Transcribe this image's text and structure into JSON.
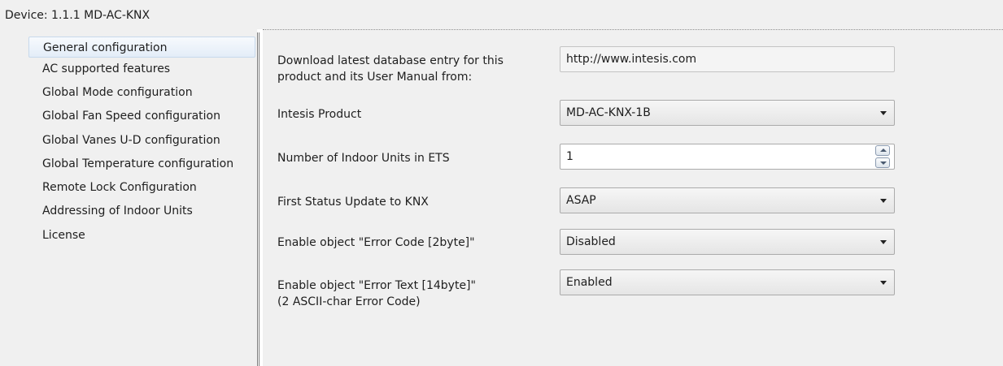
{
  "device_title": "Device: 1.1.1  MD-AC-KNX",
  "sidebar": {
    "items": [
      {
        "label": "General configuration",
        "selected": true
      },
      {
        "label": "AC supported features"
      },
      {
        "label": "Global Mode configuration"
      },
      {
        "label": "Global Fan Speed configuration"
      },
      {
        "label": "Global Vanes U-D configuration"
      },
      {
        "label": "Global Temperature configuration"
      },
      {
        "label": "Remote Lock Configuration"
      },
      {
        "label": "Addressing of Indoor Units"
      },
      {
        "label": "License"
      }
    ]
  },
  "form": {
    "download": {
      "label_line1": "Download latest database entry for this",
      "label_line2": "product and its User Manual from:",
      "value": "http://www.intesis.com"
    },
    "product": {
      "label": "Intesis Product",
      "value": "MD-AC-KNX-1B"
    },
    "indoor_units": {
      "label": "Number of Indoor Units in ETS",
      "value": "1"
    },
    "status_update": {
      "label": "First Status Update to KNX",
      "value": "ASAP"
    },
    "error_code": {
      "label": "Enable object \"Error Code [2byte]\"",
      "value": "Disabled"
    },
    "error_text": {
      "label_line1": "Enable object \"Error Text [14byte]\"",
      "label_line2": "(2 ASCII-char Error Code)",
      "value": "Enabled"
    }
  },
  "icons": {
    "dropdown": "chevron-down-icon",
    "spin_up": "arrow-up-icon",
    "spin_down": "arrow-down-icon"
  }
}
